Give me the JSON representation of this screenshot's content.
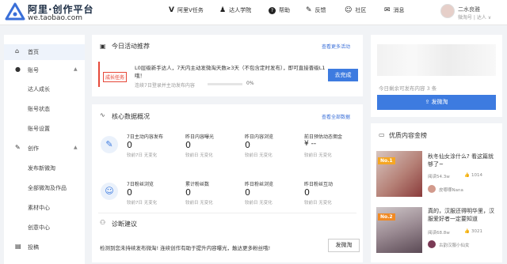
{
  "brand": {
    "title": "阿里·创作平台",
    "url": "we.taobao.com"
  },
  "nav": [
    {
      "icon": "v-icon",
      "glyph": "V",
      "label": "阿里V任务"
    },
    {
      "icon": "person-icon",
      "glyph": "♟",
      "label": "达人学院"
    },
    {
      "icon": "help-icon",
      "glyph": "?",
      "label": "帮助"
    },
    {
      "icon": "feedback-icon",
      "glyph": "✎",
      "label": "反馈"
    },
    {
      "icon": "community-icon",
      "glyph": "☺",
      "label": "社区"
    },
    {
      "icon": "mail-icon",
      "glyph": "✉",
      "label": "消息"
    }
  ],
  "user": {
    "name": "二水良雅",
    "sub": "微淘号 | 达人 ∨"
  },
  "sidebar": {
    "home": "首页",
    "account": "账号",
    "account_items": [
      "达人成长",
      "账号状态",
      "账号设置"
    ],
    "create": "创作",
    "create_items": [
      "发布新微淘",
      "全部微淘及作品",
      "素材中心",
      "创意中心"
    ],
    "submit": "投稿"
  },
  "activity": {
    "title": "今日活动推荐",
    "more": "查看更多活动",
    "tag": "成长任务",
    "text": "L0层级新手达人，7天内主动发微淘天数≥3天（不包含定时发布），即可直接晋级L1哦！",
    "sub": "连续7日登录并主动发布内容",
    "progress_pct": 0,
    "progress_label": "0%",
    "button": "去完成"
  },
  "core": {
    "title": "核心数据概况",
    "more": "查看全部数据",
    "stats": [
      {
        "label": "7日主动内容发布",
        "value": "0",
        "sub": "较前7日 无变化"
      },
      {
        "label": "昨日内容曝光",
        "value": "0",
        "sub": "较前日 无变化"
      },
      {
        "label": "昨日内容浏览",
        "value": "0",
        "sub": "较前日 无变化"
      },
      {
        "label": "前日预估动态佣金",
        "value": "¥ --",
        "sub": "较前日 无变化"
      },
      {
        "label": "7日粉丝浏览",
        "value": "0",
        "sub": "较前7日 无变化"
      },
      {
        "label": "累计粉丝数",
        "value": "0",
        "sub": "较前日 无变化"
      },
      {
        "label": "昨日粉丝浏览",
        "value": "0",
        "sub": "较前日 无变化"
      },
      {
        "label": "昨日粉丝互动",
        "value": "0",
        "sub": "较前日 无变化"
      }
    ]
  },
  "diagnosis": {
    "title": "诊断建议",
    "text": "检测到您未持续发布微淘! 连续创作有助于提升内容曝光，触达更多粉丝哦!",
    "button": "发微淘"
  },
  "publish": {
    "remaining": "今日剩余可发布内容 3 条",
    "button": "发微淘"
  },
  "ranking": {
    "title": "优质内容金榜",
    "items": [
      {
        "badge": "No.1",
        "title": "秋冬仙女涂什么? 看这篇就够了~",
        "views": "阅读54.3w",
        "likes": "1014",
        "author": "皮哪哪Nana"
      },
      {
        "badge": "No.2",
        "title": "真的，汉服还得明华里，汉服爱好者一定要知道",
        "views": "阅读68.8w",
        "likes": "3021",
        "author": "古韵汉服小仙女"
      }
    ]
  }
}
